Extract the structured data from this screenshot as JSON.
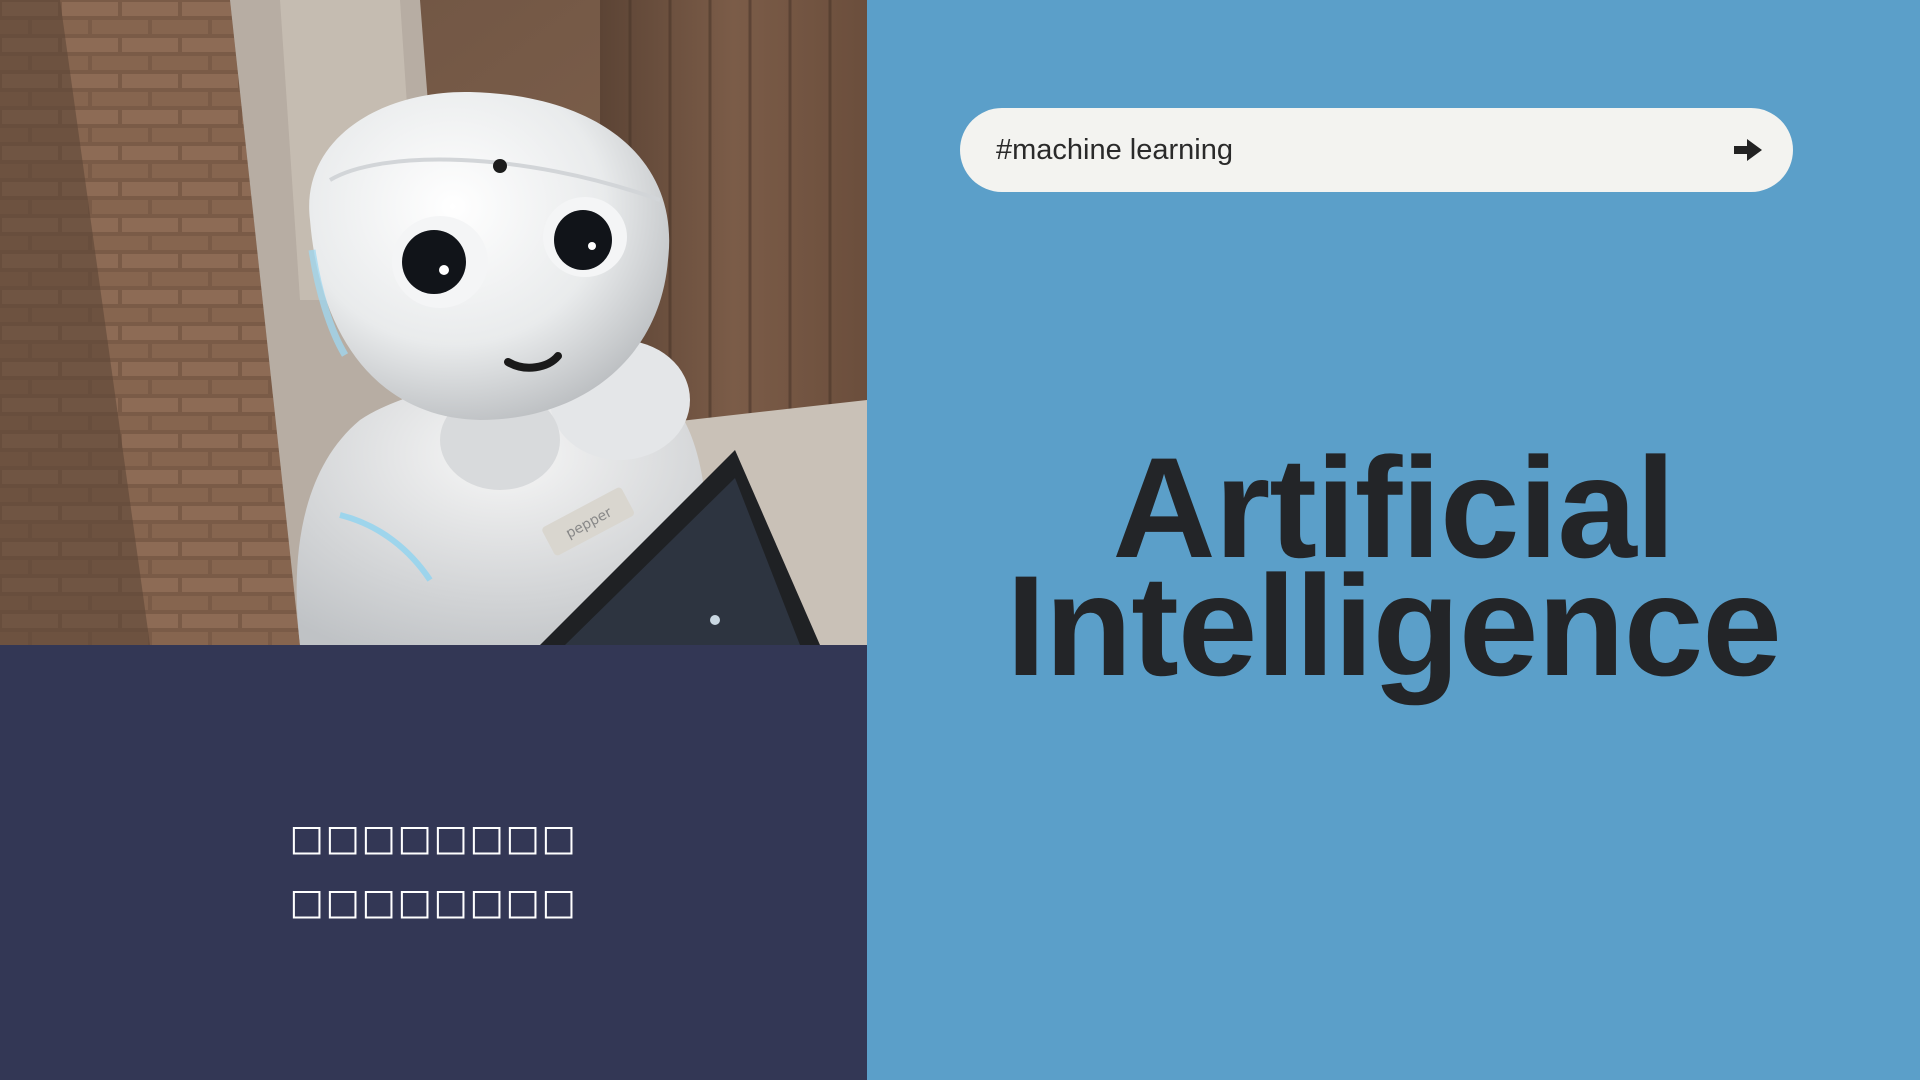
{
  "colors": {
    "left_dark": "#333755",
    "right_blue": "#5b9fc9",
    "pill_bg": "#f3f3f0",
    "headline_text": "#232528",
    "caption_text": "#ffffff",
    "search_text": "#2a2a2a"
  },
  "photo": {
    "subject": "white humanoid robot holding a tablet, brick wall background",
    "badge_text": "pepper"
  },
  "caption": {
    "line1": "□□□□□□□□",
    "line2": "□□□□□□□□"
  },
  "search": {
    "query": "#machine learning",
    "submit_icon": "arrow-right-icon"
  },
  "headline": {
    "line1": "Artificial",
    "line2": "Intelligence"
  }
}
